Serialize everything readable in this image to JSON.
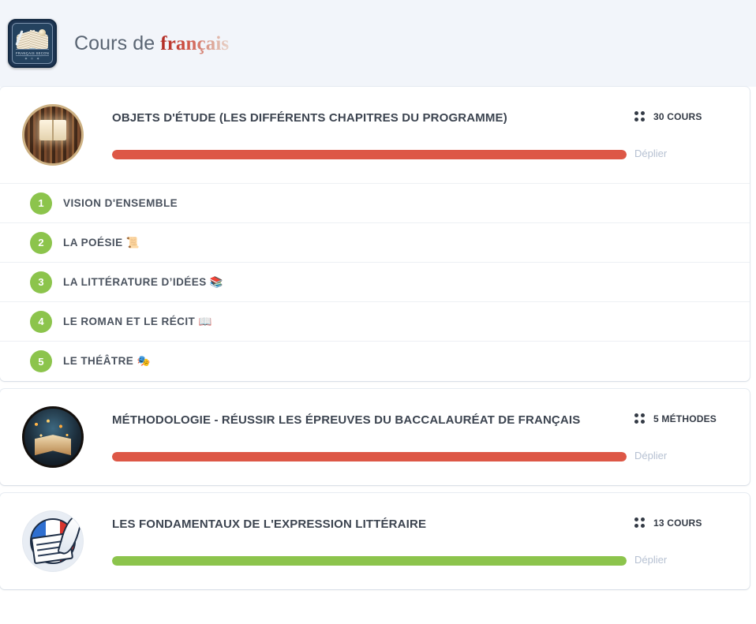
{
  "header": {
    "logo_alt": "badge-livre-francais-seconde",
    "logo_ribbon_text": "FRANÇAIS SECONDE",
    "logo_stars": "✦ ✧ ✦",
    "title_prefix": "Cours de ",
    "title_accent": "français",
    "accent_color": "#c0392b",
    "background_color": "#f2f5fa"
  },
  "colors": {
    "progress_red": "#dd5746",
    "progress_green": "#8cc44c",
    "badge_green": "#8cc44c",
    "text_dark": "#3c4450",
    "link_muted": "#b6c1d2"
  },
  "cards": [
    {
      "id": "objets-detude",
      "thumb": "library-thumbnail",
      "title": "OBJETS D'ÉTUDE (LES DIFFÉRENTS CHAPITRES DU PROGRAMME)",
      "count_label": "30 COURS",
      "expand_label": "Déplier",
      "progress_percent": 100,
      "progress_color": "#dd5746",
      "chapters": [
        {
          "number": "1",
          "label": "VISION D'ENSEMBLE"
        },
        {
          "number": "2",
          "label": "LA POÉSIE 📜"
        },
        {
          "number": "3",
          "label": "LA LITTÉRATURE D’IDÉES 📚"
        },
        {
          "number": "4",
          "label": "LE ROMAN ET LE RÉCIT 📖"
        },
        {
          "number": "5",
          "label": "LE THÉÂTRE 🎭"
        }
      ]
    },
    {
      "id": "methodologie",
      "thumb": "magic-book-thumbnail",
      "title": "MÉTHODOLOGIE - RÉUSSIR LES ÉPREUVES DU BACCALAURÉAT DE FRANÇAIS",
      "count_label": "5 MÉTHODES",
      "expand_label": "Déplier",
      "progress_percent": 100,
      "progress_color": "#dd5746",
      "chapters": []
    },
    {
      "id": "fondamentaux",
      "thumb": "quill-flag-thumbnail",
      "title": "LES FONDAMENTAUX DE L'EXPRESSION LITTÉRAIRE",
      "count_label": "13 COURS",
      "expand_label": "Déplier",
      "progress_percent": 100,
      "progress_color": "#8cc44c",
      "chapters": []
    }
  ]
}
